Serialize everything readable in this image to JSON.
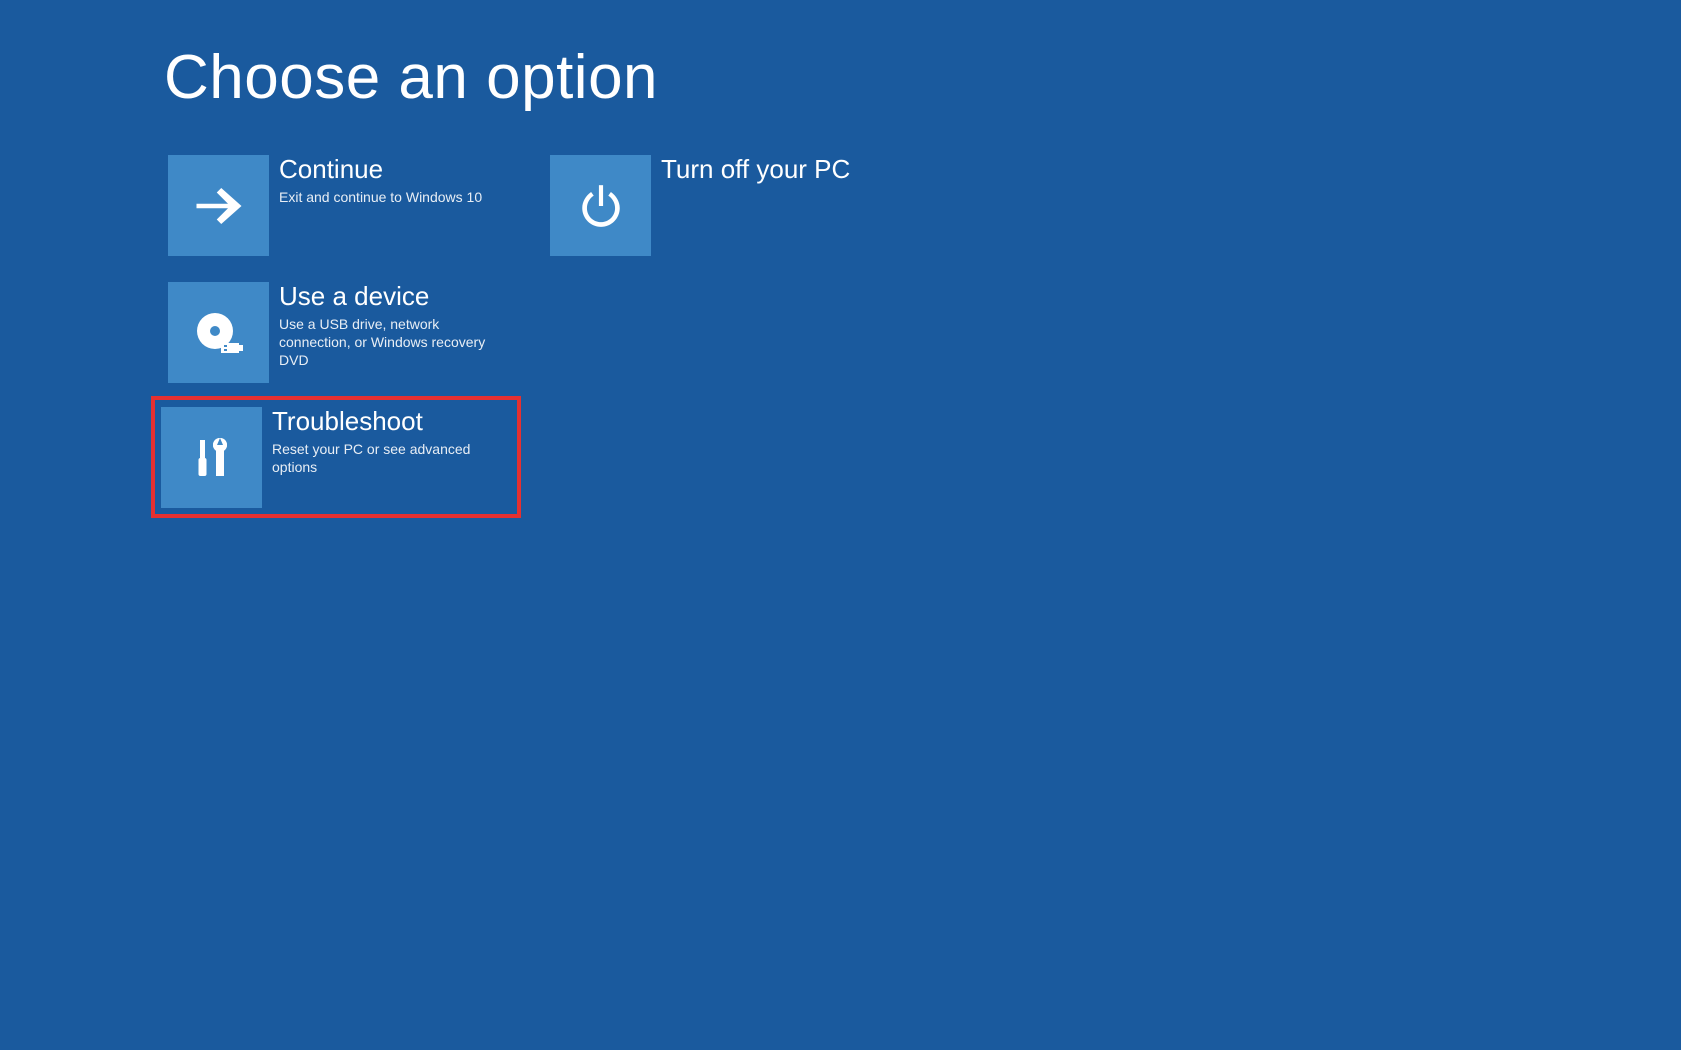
{
  "page": {
    "title": "Choose an option"
  },
  "options": {
    "continue": {
      "title": "Continue",
      "description": "Exit and continue to Windows 10"
    },
    "turnoff": {
      "title": "Turn off your PC",
      "description": ""
    },
    "usedevice": {
      "title": "Use a device",
      "description": "Use a USB drive, network connection, or Windows recovery DVD"
    },
    "troubleshoot": {
      "title": "Troubleshoot",
      "description": "Reset your PC or see advanced options"
    }
  },
  "colors": {
    "background": "#1a5a9e",
    "tile": "#3f89c7",
    "highlight": "#e63030"
  }
}
